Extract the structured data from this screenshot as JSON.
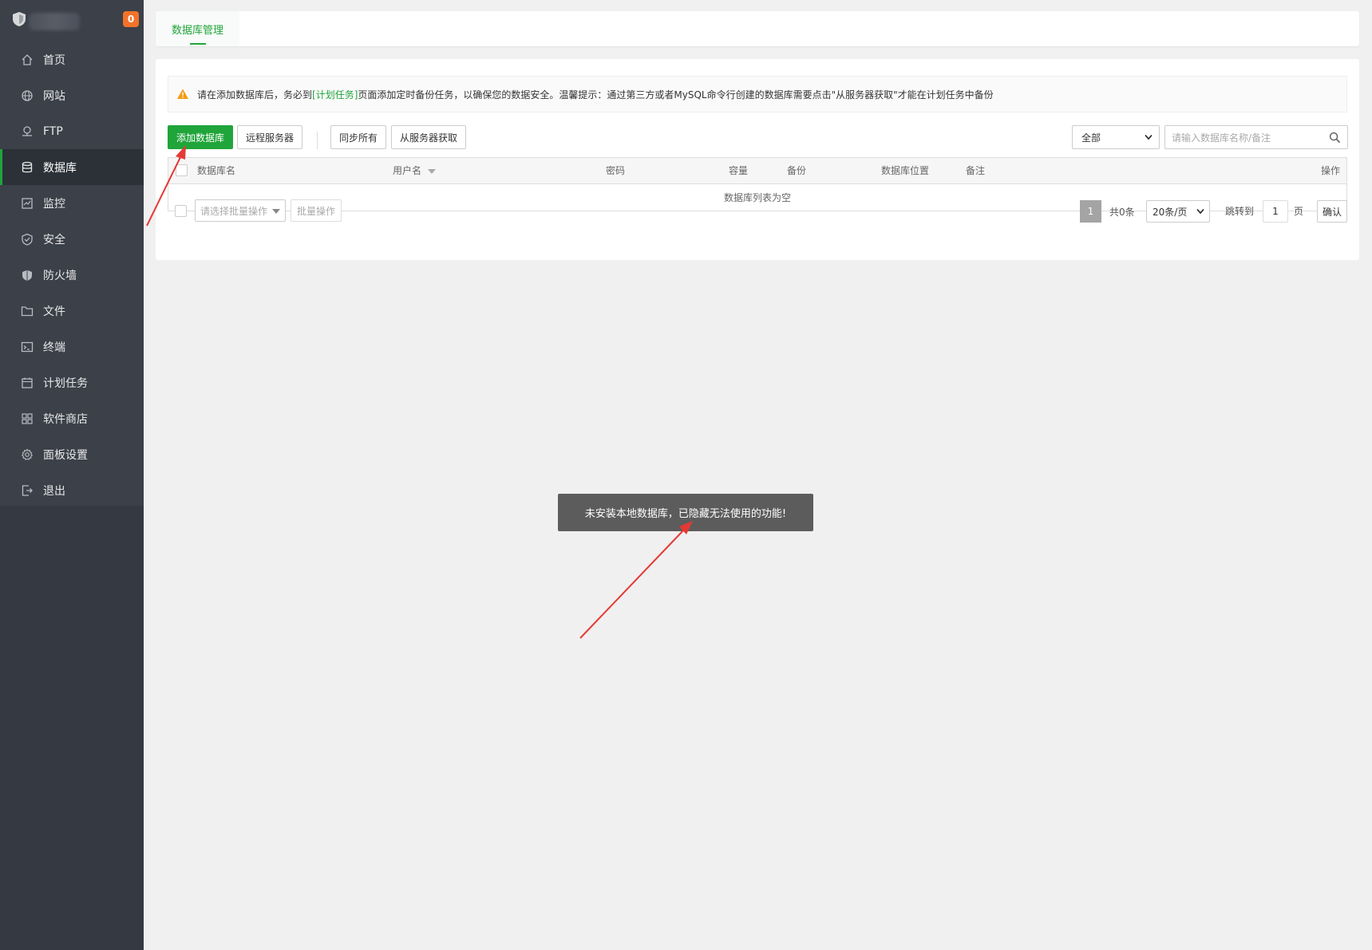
{
  "sidebar": {
    "badge": "0",
    "items": [
      {
        "label": "首页",
        "icon": "home-icon"
      },
      {
        "label": "网站",
        "icon": "globe-icon"
      },
      {
        "label": "FTP",
        "icon": "ftp-icon"
      },
      {
        "label": "数据库",
        "icon": "database-icon",
        "active": true
      },
      {
        "label": "监控",
        "icon": "monitor-icon"
      },
      {
        "label": "安全",
        "icon": "shield-check-icon"
      },
      {
        "label": "防火墙",
        "icon": "firewall-icon"
      },
      {
        "label": "文件",
        "icon": "folder-icon"
      },
      {
        "label": "终端",
        "icon": "terminal-icon"
      },
      {
        "label": "计划任务",
        "icon": "calendar-icon"
      },
      {
        "label": "软件商店",
        "icon": "apps-icon"
      },
      {
        "label": "面板设置",
        "icon": "gear-icon"
      },
      {
        "label": "退出",
        "icon": "logout-icon"
      }
    ]
  },
  "tabs": {
    "active": "数据库管理"
  },
  "alert": {
    "before": "请在添加数据库后，务必到",
    "link": "[计划任务]",
    "after": "页面添加定时备份任务，以确保您的数据安全。温馨提示：通过第三方或者MySQL命令行创建的数据库需要点击\"从服务器获取\"才能在计划任务中备份"
  },
  "toolbar": {
    "add_db": "添加数据库",
    "remote_server": "远程服务器",
    "sync_all": "同步所有",
    "fetch_from_server": "从服务器获取",
    "filter_value": "全部",
    "search_placeholder": "请输入数据库名称/备注"
  },
  "table": {
    "headers": {
      "name": "数据库名",
      "username": "用户名",
      "password": "密码",
      "capacity": "容量",
      "backup": "备份",
      "location": "数据库位置",
      "remark": "备注",
      "actions": "操作"
    },
    "empty": "数据库列表为空"
  },
  "footer": {
    "batch_select_placeholder": "请选择批量操作",
    "batch_button": "批量操作",
    "current_page": "1",
    "total": "共0条",
    "per_page": "20条/页",
    "jump_to": "跳转到",
    "jump_value": "1",
    "page_unit": "页",
    "confirm": "确认"
  },
  "toast": "未安装本地数据库，已隐藏无法使用的功能!",
  "colors": {
    "accent": "#20a53a",
    "sidebar": "#3b4049",
    "badge": "#f1722a",
    "annotation": "#e53935"
  }
}
